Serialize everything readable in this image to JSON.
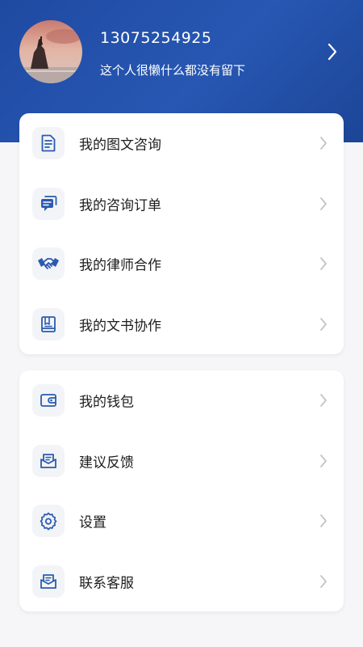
{
  "profile": {
    "phone": "13075254925",
    "signature": "这个人很懒什么都没有留下",
    "avatar_icon": "avatar-photo-icon"
  },
  "colors": {
    "header_blue": "#2251ab",
    "icon_blue": "#2a5bb0",
    "chevron_gray": "#c4c4c8",
    "page_bg": "#f6f6f8"
  },
  "menu_group_1": [
    {
      "label": "我的图文咨询",
      "icon": "document-icon"
    },
    {
      "label": "我的咨询订单",
      "icon": "chat-bubble-icon"
    },
    {
      "label": "我的律师合作",
      "icon": "handshake-icon"
    },
    {
      "label": "我的文书协作",
      "icon": "book-icon"
    }
  ],
  "menu_group_2": [
    {
      "label": "我的钱包",
      "icon": "wallet-icon"
    },
    {
      "label": "建议反馈",
      "icon": "feedback-mail-icon"
    },
    {
      "label": "设置",
      "icon": "gear-icon"
    },
    {
      "label": "联系客服",
      "icon": "service-mail-icon"
    }
  ]
}
